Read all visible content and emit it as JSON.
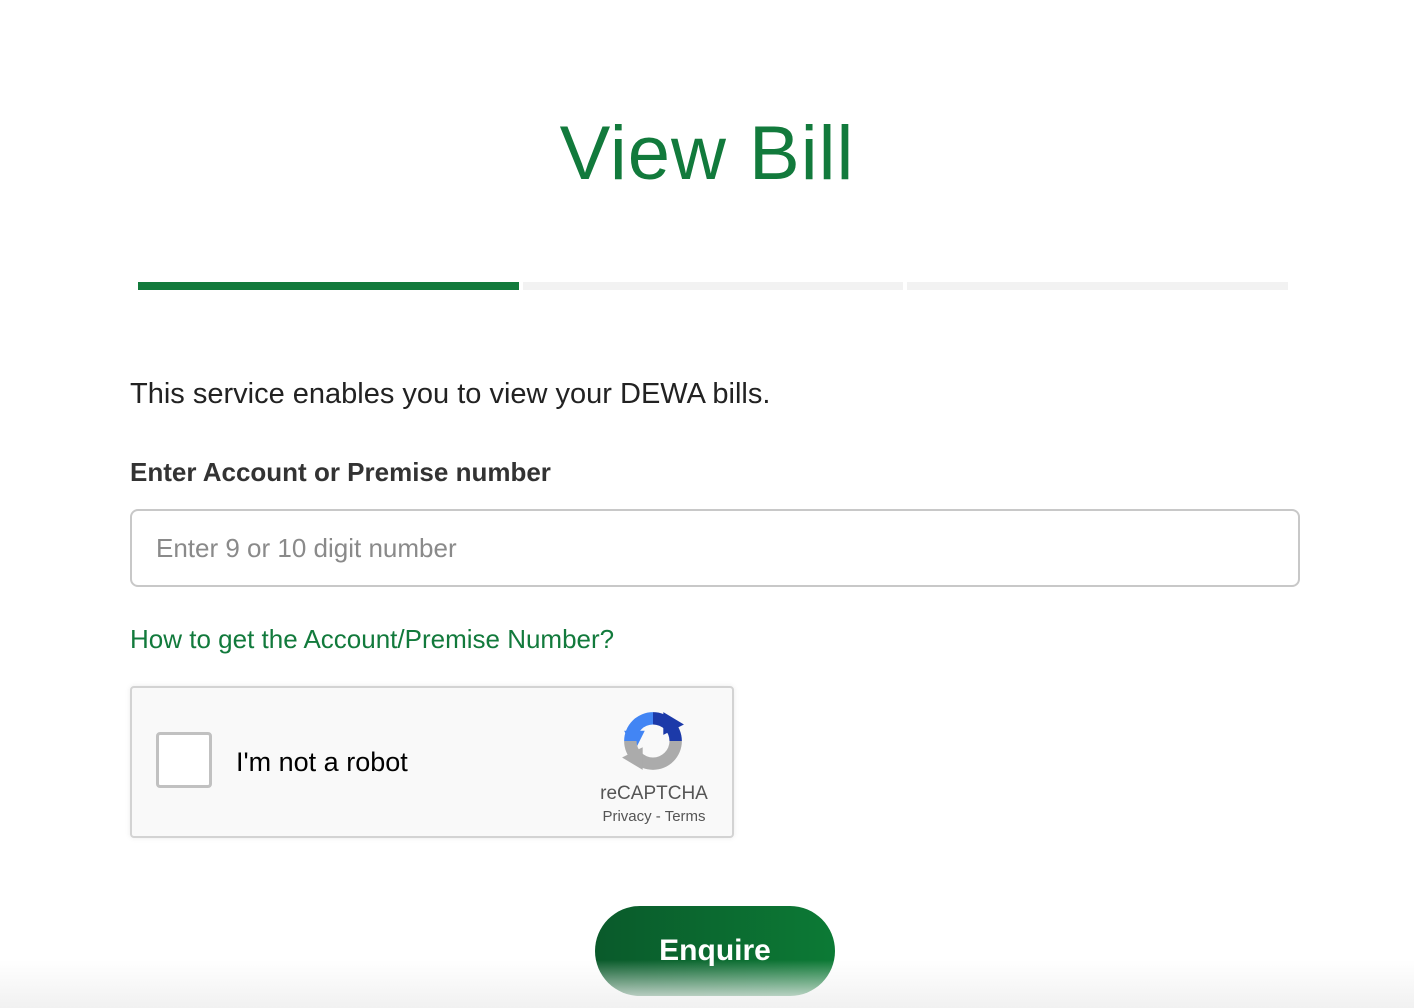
{
  "page": {
    "title": "View Bill",
    "intro": "This service enables you to view your DEWA bills."
  },
  "stepper": {
    "total_steps": 3,
    "current_step": 1
  },
  "form": {
    "account_label": "Enter Account or Premise number",
    "account_placeholder": "Enter 9 or 10 digit number",
    "account_value": "",
    "help_link": "How to get the Account/Premise Number?",
    "submit_label": "Enquire"
  },
  "recaptcha": {
    "label": "I'm not a robot",
    "brand": "reCAPTCHA",
    "privacy": "Privacy",
    "separator": "-",
    "terms": "Terms",
    "checked": false
  },
  "colors": {
    "brand_green": "#127a3c",
    "button_green_dark": "#0a5a2b",
    "button_green_light": "#0c7a35",
    "step_inactive": "#f2f2f2"
  },
  "icons": {
    "recaptcha_logo": "recaptcha-logo-icon"
  }
}
